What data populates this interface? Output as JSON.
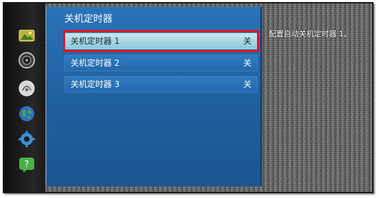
{
  "panel": {
    "title": "关机定时器",
    "items": [
      {
        "label": "关机定时器 1",
        "value": "关",
        "selected": true
      },
      {
        "label": "关机定时器 2",
        "value": "关",
        "selected": false
      },
      {
        "label": "关机定时器 3",
        "value": "关",
        "selected": false
      }
    ]
  },
  "help_text": "配置自动关机定时器 1。",
  "sidebar": {
    "icons": [
      "picture-icon",
      "sound-icon",
      "broadcast-icon",
      "network-icon",
      "system-gear-icon",
      "support-help-icon"
    ]
  },
  "colors": {
    "panel_blue": "#2469ad",
    "selected_item": "#8ccad7",
    "highlight_red": "#e3151b"
  }
}
